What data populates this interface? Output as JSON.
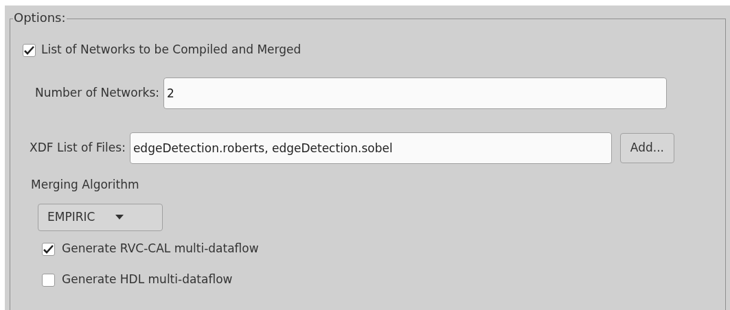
{
  "group": {
    "title": "Options:"
  },
  "compile_option": {
    "label": "List of Networks to be Compiled and Merged",
    "checked": true
  },
  "number_of_networks": {
    "label": "Number of Networks:",
    "value": "2"
  },
  "xdf_files": {
    "label": "XDF List of Files:",
    "value": "edgeDetection.roberts, edgeDetection.sobel",
    "button": "Add..."
  },
  "merging_algorithm": {
    "label": "Merging Algorithm",
    "value": "EMPIRIC"
  },
  "outputs": [
    {
      "label": "Generate RVC-CAL multi-dataflow",
      "checked": true
    },
    {
      "label": "Generate HDL multi-dataflow",
      "checked": false
    }
  ]
}
